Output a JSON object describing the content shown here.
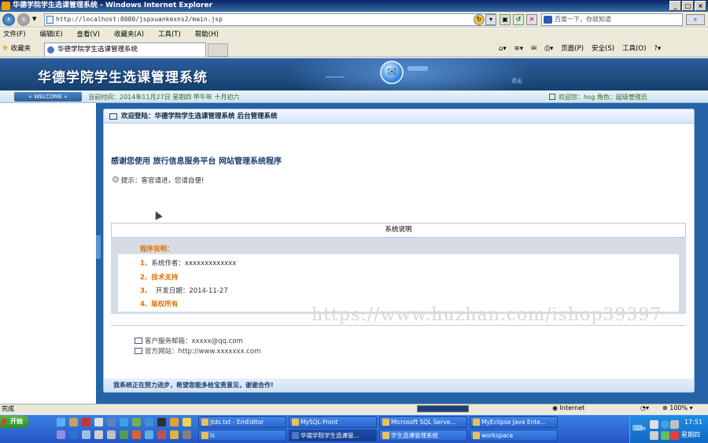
{
  "window": {
    "title": "华德学院学生选课管理系统 - Windows Internet Explorer"
  },
  "browser": {
    "url": "http://localhost:8080/jspxuankexns2/main.jsp",
    "search_placeholder": "百度一下，你就知道",
    "menu": [
      "文件(F)",
      "编辑(E)",
      "查看(V)",
      "收藏夹(A)",
      "工具(T)",
      "帮助(H)"
    ],
    "favorites_label": "收藏夹",
    "tab_title": "华德学院学生选课管理系统",
    "commands": [
      "页面(P)",
      "安全(S)",
      "工具(O)"
    ]
  },
  "site": {
    "title": "华德学院学生选课管理系统",
    "welcome": "WELCOME",
    "current_time": "当前时间：2014年11月27日 星期四 甲午年 十月初六",
    "user_info": "欢迎您：hsg 角色：超级管理员",
    "banner_links": [
      "退出"
    ]
  },
  "panel": {
    "heading": "欢迎登陆：华德学院学生选课管理系统 后台管理系统",
    "thanks": "感谢您使用 旅行信息服务平台 网站管理系统程序",
    "tip": "提示：客官请进，您请自便!",
    "section_title": "系统说明",
    "program_title": "程序说明：",
    "items": [
      {
        "num": "1、",
        "text": "系统作者：xxxxxxxxxxxxx"
      },
      {
        "num": "2、",
        "text": "技术支持"
      },
      {
        "num": "3、",
        "text": "开发日期：2014-11-27"
      },
      {
        "num": "4、",
        "text": "版权所有"
      }
    ],
    "email": "客户服务邮箱：xxxxx@qq.com",
    "website": "官方网站：http://www.xxxxxxx.com",
    "footer": "我系统正在努力进步，希望您能多给宝贵意见，谢谢合作!"
  },
  "watermark": "https://www.huzhan.com/ishop39397",
  "statusbar": {
    "text": "完成",
    "zone": "Internet",
    "zoom": "100%"
  },
  "taskbar": {
    "start": "开始",
    "tasks_row1": [
      "jtds.txt - EmEditor",
      "MySQL-Front",
      "Microsoft SQL Serve...",
      "MyEclipse Java Ente..."
    ],
    "tasks_row2": [
      "ls",
      "华德学院学生选课管...",
      "学生选课管理系统",
      "workspace"
    ],
    "clock": "17:51",
    "weekday": "星期四"
  }
}
